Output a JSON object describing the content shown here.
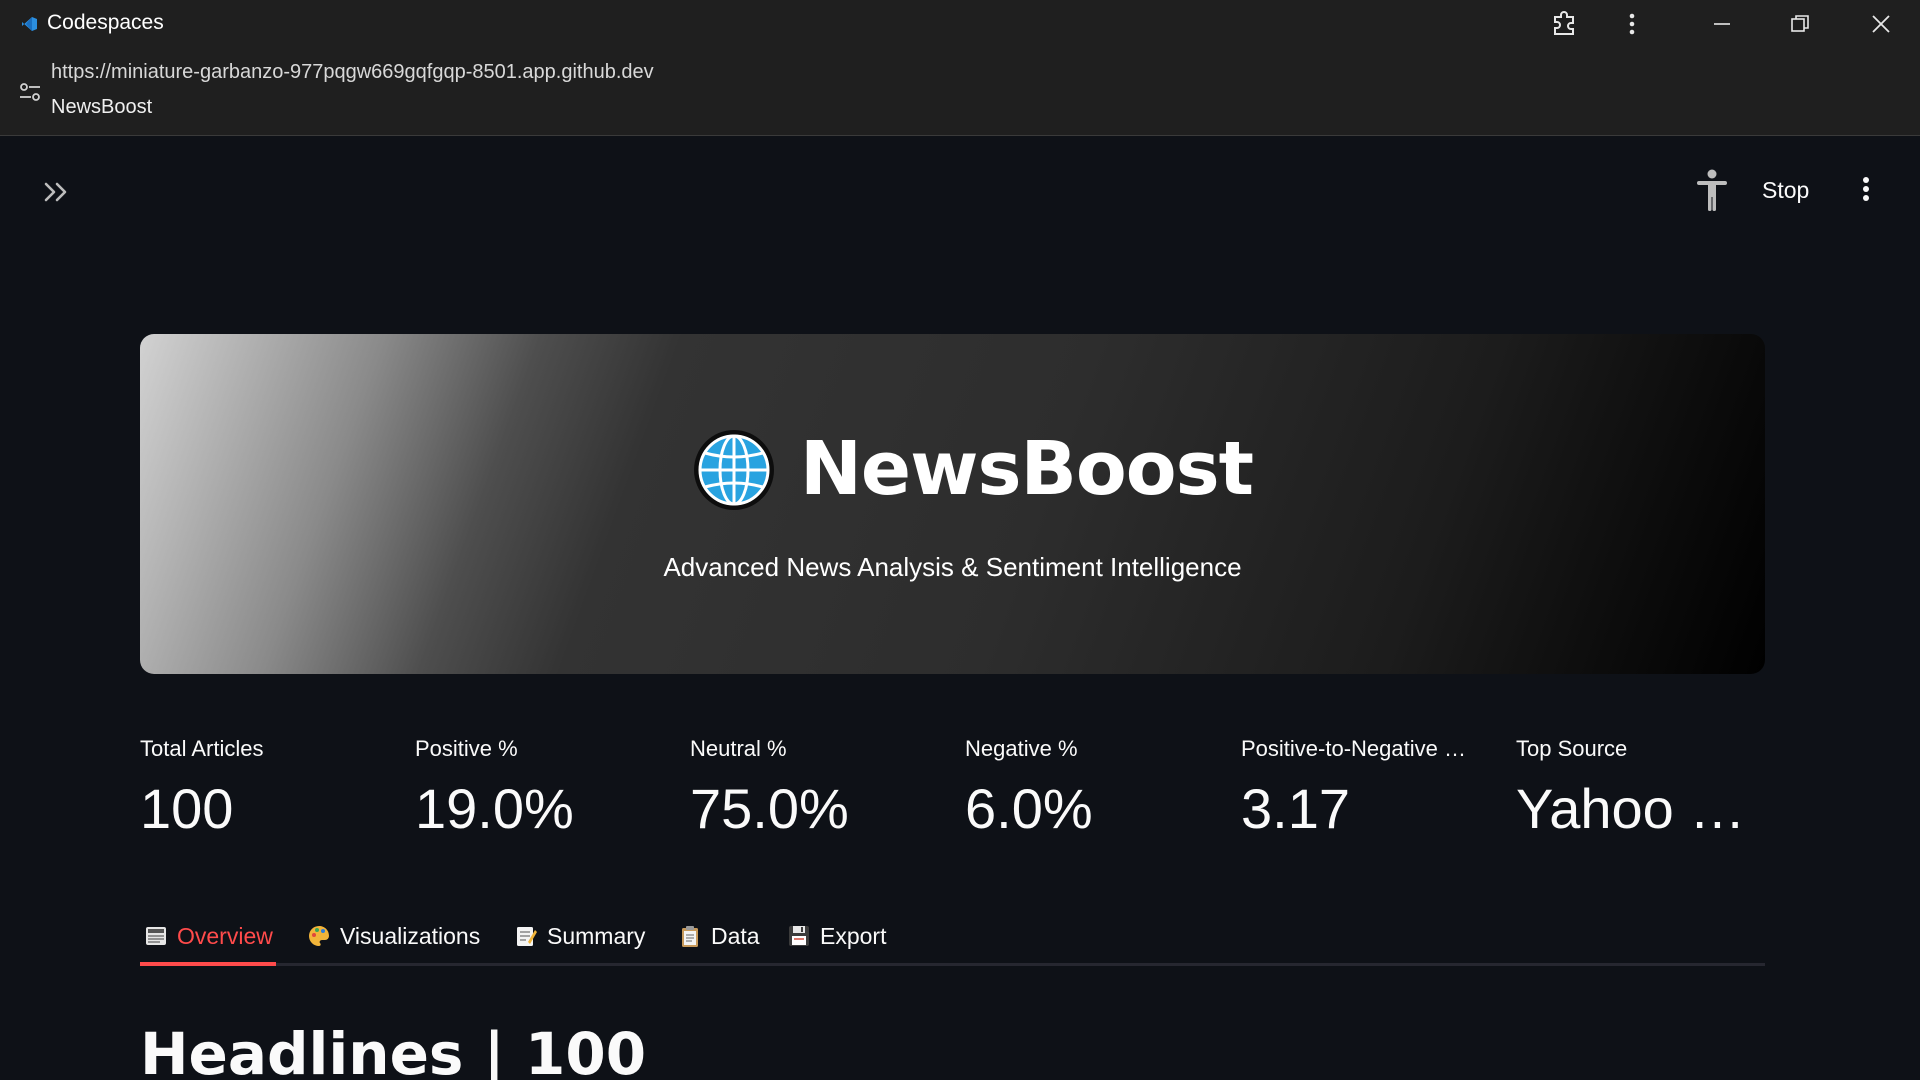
{
  "window": {
    "title": "Codespaces"
  },
  "address": {
    "url": "https://miniature-garbanzo-977pqgw669gqfgqp-8501.app.github.dev",
    "page_title": "NewsBoost"
  },
  "header": {
    "stop_label": "Stop"
  },
  "hero": {
    "title": "NewsBoost",
    "subtitle": "Advanced News Analysis & Sentiment Intelligence"
  },
  "metrics": [
    {
      "label": "Total Articles",
      "value": "100"
    },
    {
      "label": "Positive %",
      "value": "19.0%"
    },
    {
      "label": "Neutral %",
      "value": "75.0%"
    },
    {
      "label": "Negative %",
      "value": "6.0%"
    },
    {
      "label": "Positive-to-Negative …",
      "value": "3.17"
    },
    {
      "label": "Top Source",
      "value": "Yahoo …"
    }
  ],
  "tabs": [
    {
      "label": "Overview",
      "icon": "newspaper-icon"
    },
    {
      "label": "Visualizations",
      "icon": "palette-icon"
    },
    {
      "label": "Summary",
      "icon": "memo-icon"
    },
    {
      "label": "Data",
      "icon": "clipboard-icon"
    },
    {
      "label": "Export",
      "icon": "floppy-disk-icon"
    }
  ],
  "main": {
    "heading": "Headlines | 100"
  },
  "colors": {
    "accent": "#ff4b4b",
    "background": "#0e1117",
    "chrome": "#1f1f1f"
  }
}
